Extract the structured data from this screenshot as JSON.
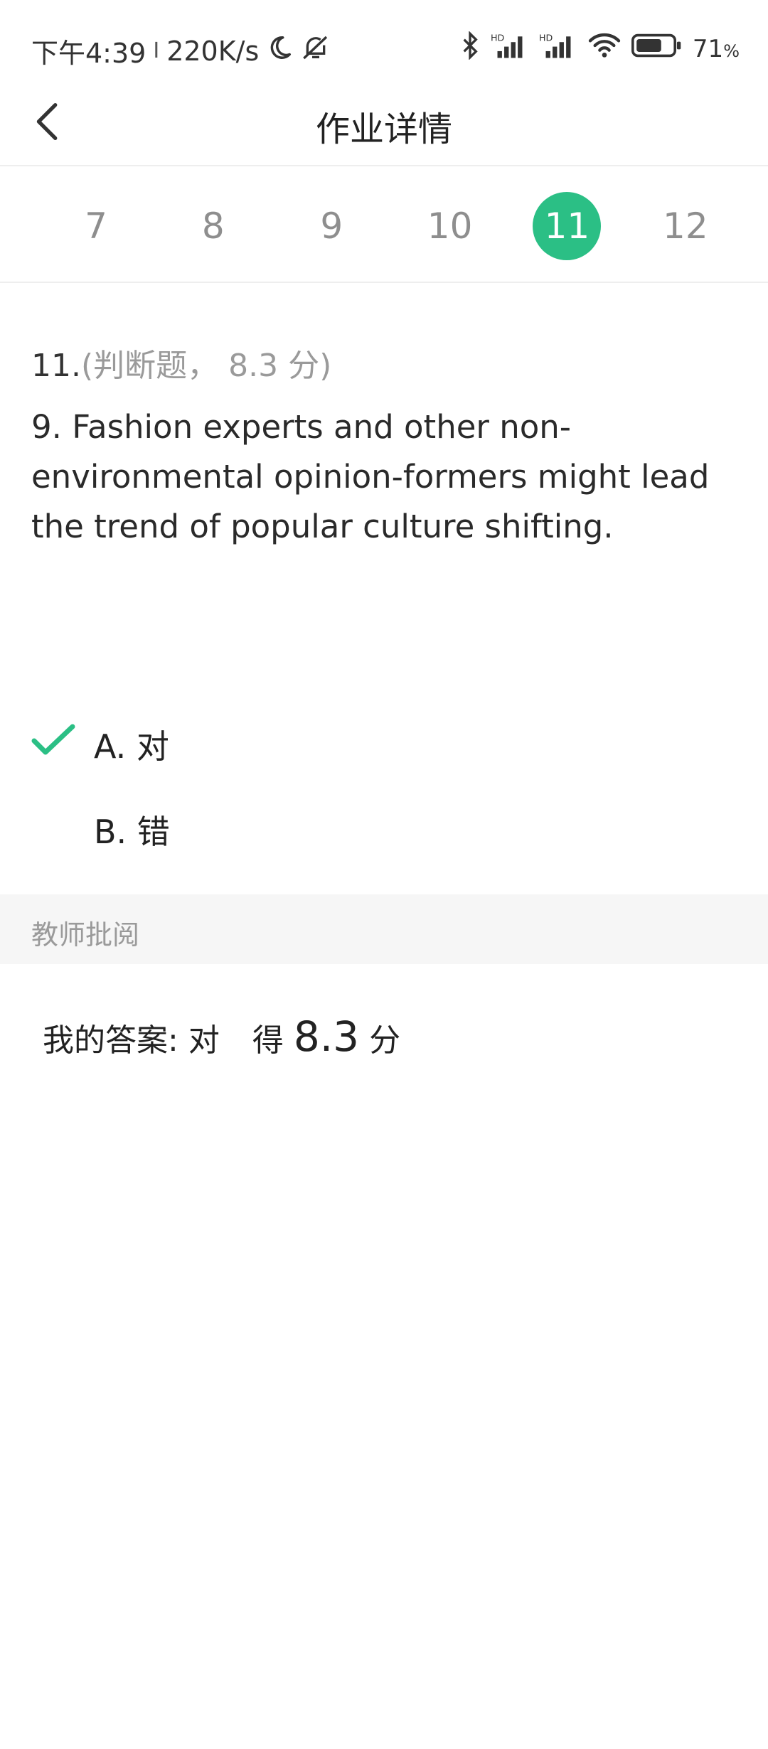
{
  "status_bar": {
    "time": "下午4:39",
    "divider": "I",
    "net_speed": "220K/s",
    "battery_percent": "71",
    "battery_unit": "%",
    "battery_level": 0.71,
    "icons": [
      "moon-icon",
      "mute-icon",
      "bluetooth-icon",
      "signal-hd-icon",
      "signal-hd-icon",
      "wifi-icon",
      "battery-icon"
    ]
  },
  "app_bar": {
    "title": "作业详情",
    "back_icon": "chevron-left-icon"
  },
  "question_nav": {
    "numbers": [
      "7",
      "8",
      "9",
      "10",
      "11",
      "12"
    ],
    "active": "11",
    "accent_color": "#2bbf85"
  },
  "question": {
    "number": "11.",
    "meta": "(判断题， 8.3 分)",
    "text": "9. Fashion experts and other non-environmental opinion-formers might lead the trend of popular culture shifting."
  },
  "options": [
    {
      "label": "A. 对",
      "selected": true
    },
    {
      "label": "B. 错",
      "selected": false
    }
  ],
  "review": {
    "header": "教师批阅",
    "my_answer_label": "我的答案:",
    "my_answer_value": "对",
    "score_prefix": "得",
    "score_value": "8.3",
    "score_suffix": "分"
  }
}
